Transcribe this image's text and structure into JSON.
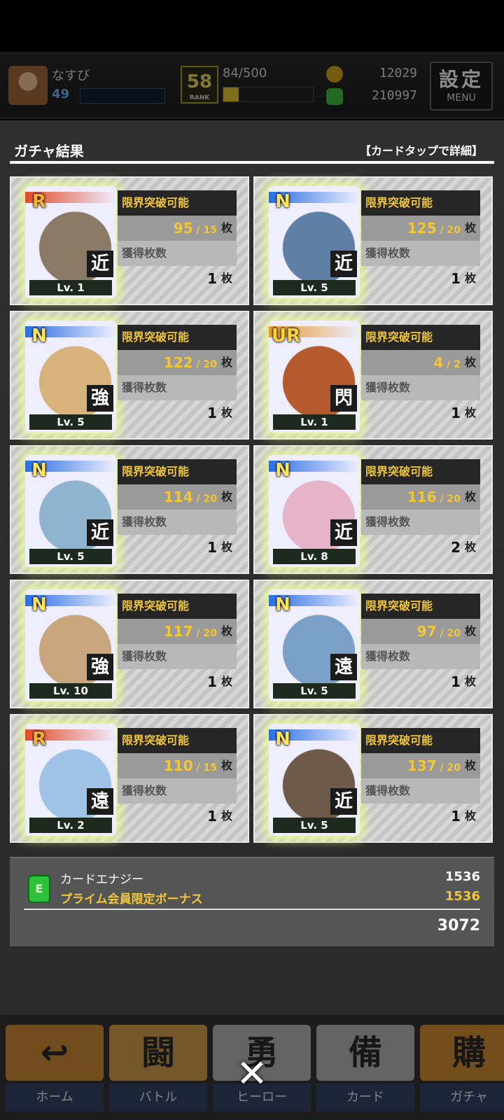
{
  "topbar": {
    "player_name": "なすび",
    "player_level": "49",
    "player_level_fill": 0.0,
    "rank_label": "RANK",
    "rank_value": "58",
    "rank_progress_text": "84/500",
    "rank_progress_fill": 0.168,
    "currency_gold": "12029",
    "currency_green": "210997",
    "menu_kanji": "設定",
    "menu_label": "MENU"
  },
  "results": {
    "title": "ガチャ結果",
    "tap_hint": "【カードタップで詳細】",
    "limit_break_label": "限界突破可能",
    "obtained_label": "獲得枚数",
    "unit": "枚",
    "cards": [
      {
        "rarity": "R",
        "role": "近",
        "level": "Lv. 1",
        "owned": "95",
        "required": "15",
        "obtained": "1",
        "art_color": "#8a7a66"
      },
      {
        "rarity": "N",
        "role": "近",
        "level": "Lv. 5",
        "owned": "125",
        "required": "20",
        "obtained": "1",
        "art_color": "#5e7fa6"
      },
      {
        "rarity": "N",
        "role": "強",
        "level": "Lv. 5",
        "owned": "122",
        "required": "20",
        "obtained": "1",
        "art_color": "#d7b27a"
      },
      {
        "rarity": "UR",
        "role": "閃",
        "level": "Lv. 1",
        "owned": "4",
        "required": "2",
        "obtained": "1",
        "art_color": "#b55a2c"
      },
      {
        "rarity": "N",
        "role": "近",
        "level": "Lv. 5",
        "owned": "114",
        "required": "20",
        "obtained": "1",
        "art_color": "#8fb4cf"
      },
      {
        "rarity": "N",
        "role": "近",
        "level": "Lv. 8",
        "owned": "116",
        "required": "20",
        "obtained": "2",
        "art_color": "#e6b3c8"
      },
      {
        "rarity": "N",
        "role": "強",
        "level": "Lv. 10",
        "owned": "117",
        "required": "20",
        "obtained": "1",
        "art_color": "#c9a57e"
      },
      {
        "rarity": "N",
        "role": "遠",
        "level": "Lv. 5",
        "owned": "97",
        "required": "20",
        "obtained": "1",
        "art_color": "#7aa0c8"
      },
      {
        "rarity": "R",
        "role": "遠",
        "level": "Lv. 2",
        "owned": "110",
        "required": "15",
        "obtained": "1",
        "art_color": "#9fc3e6"
      },
      {
        "rarity": "N",
        "role": "近",
        "level": "Lv. 5",
        "owned": "137",
        "required": "20",
        "obtained": "1",
        "art_color": "#6f5a4a"
      }
    ]
  },
  "energy": {
    "icon_letter": "E",
    "name": "カードエナジー",
    "value": "1536",
    "bonus_name": "プライム会員限定ボーナス",
    "bonus_value": "1536",
    "total": "3072"
  },
  "bottom_nav": [
    {
      "label": "ホーム",
      "icon": "↩",
      "icon_bg": "#d88a1f"
    },
    {
      "label": "バトル",
      "icon": "闘",
      "icon_bg": "#e0a23a"
    },
    {
      "label": "ヒーロー",
      "icon": "勇",
      "icon_bg": "#b9b9b9"
    },
    {
      "label": "カード",
      "icon": "備",
      "icon_bg": "#b9b9b9"
    },
    {
      "label": "ガチャ",
      "icon": "購",
      "icon_bg": "#e08a1f"
    }
  ],
  "close_label": "✕"
}
